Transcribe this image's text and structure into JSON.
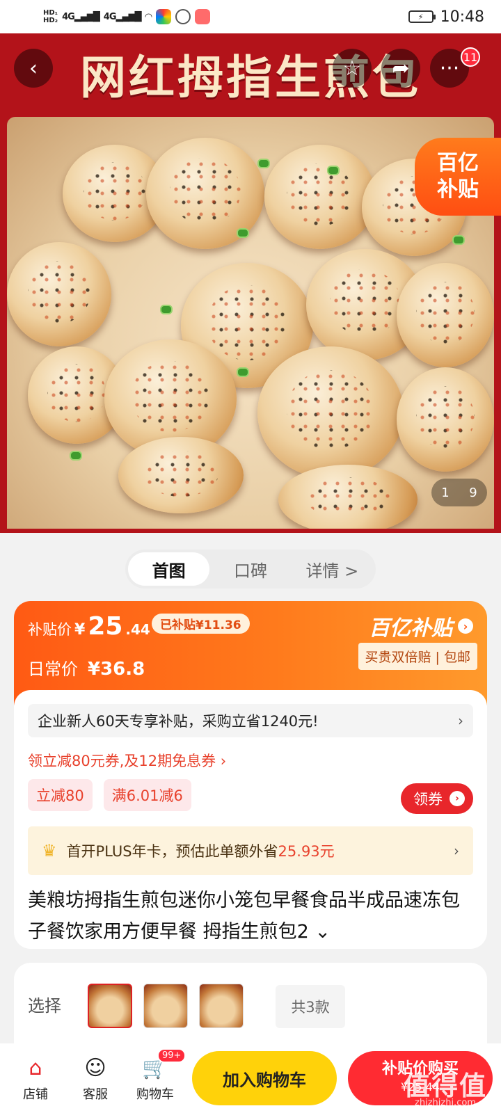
{
  "status_bar": {
    "hd1": "HD₁",
    "hd2": "HD₂",
    "signal1": "4G",
    "signal2": "4G",
    "time": "10:48"
  },
  "hero": {
    "title": "网红拇指生煎包",
    "cart_badge": "11",
    "subsidy_badge_line1": "百亿",
    "subsidy_badge_line2": "补贴",
    "pager_current": "1",
    "pager_total": "9"
  },
  "tabs": [
    {
      "label": "首图",
      "active": true
    },
    {
      "label": "口碑",
      "active": false
    },
    {
      "label": "详情 >",
      "active": false
    }
  ],
  "price": {
    "subsidy_label": "补贴价",
    "currency": "¥",
    "subsidy_int": "25",
    "subsidy_dec": ".44",
    "saved_tag": "已补贴¥11.36",
    "daily_label": "日常价",
    "daily_price": "¥36.8",
    "program_name": "百亿补贴",
    "guarantee": "买贵双倍赔 | 包邮"
  },
  "promo": {
    "notice": "企业新人60天专享补贴，采购立省1240元!",
    "coupon_line": "领立减80元券,及12期免息券 ›",
    "chips": [
      "立减80",
      "满6.01减6"
    ],
    "get_coupon_label": "领券",
    "plus_text_prefix": "首开PLUS年卡，预估此单额外省",
    "plus_amount": "25.93",
    "plus_text_suffix": "元"
  },
  "product": {
    "title": "美粮坊拇指生煎包迷你小笼包早餐食品半成品速冻包子餐饮家用方便早餐 拇指生煎包2 ⌄"
  },
  "variants": {
    "label": "选择",
    "total_label": "共3款"
  },
  "bottom_bar": {
    "store": "店铺",
    "service": "客服",
    "cart": "购物车",
    "cart_badge": "99+",
    "add_cart": "加入购物车",
    "buy_line1": "补贴价购买",
    "buy_line2": "¥25.44"
  },
  "watermark": {
    "text": "值得值",
    "url": "zhizhizhi.com"
  },
  "colors": {
    "hero_red": "#b3131a",
    "subsidy_orange": "#ff5a14",
    "cart_yellow": "#ffd20a",
    "buy_red": "#ff2b32"
  }
}
